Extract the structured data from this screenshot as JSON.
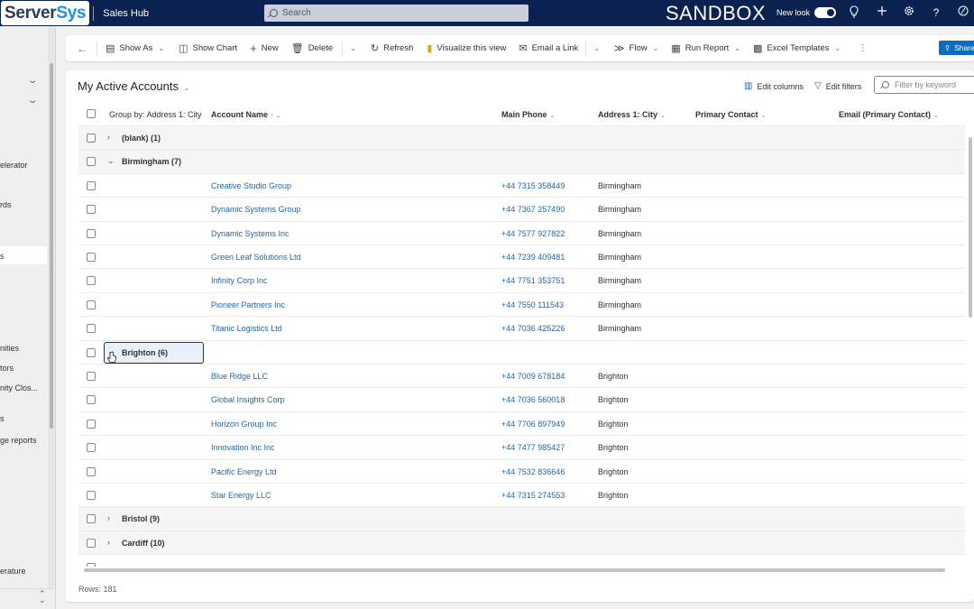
{
  "topbar": {
    "logo_part1": "Server",
    "logo_part2": "Sys",
    "app_name": "Sales Hub",
    "search_placeholder": "Search",
    "environment_label": "SANDBOX",
    "new_look_label": "New look",
    "new_look_enabled": true,
    "icons": [
      "lightbulb-icon",
      "plus-icon",
      "settings-icon",
      "help-icon",
      "copilot-icon"
    ]
  },
  "sidebar": {
    "items": [
      {
        "label": "",
        "has_chevron": true
      },
      {
        "label": "",
        "has_chevron": true
      },
      {
        "label": "elerator"
      },
      {
        "label": "rds"
      },
      {
        "label": "s",
        "selected": true
      },
      {
        "label": "nities"
      },
      {
        "label": "tors"
      },
      {
        "label": "nity Clos..."
      },
      {
        "label": "s"
      },
      {
        "label": "ge reports"
      },
      {
        "label": "erature"
      }
    ]
  },
  "commandbar": {
    "back_label": "←",
    "show_as": "Show As",
    "show_chart": "Show Chart",
    "new": "New",
    "delete": "Delete",
    "refresh": "Refresh",
    "visualize": "Visualize this view",
    "email_link": "Email a Link",
    "flow": "Flow",
    "run_report": "Run Report",
    "excel_templates": "Excel Templates",
    "share": "Share"
  },
  "view": {
    "title": "My Active Accounts",
    "edit_columns": "Edit columns",
    "edit_filters": "Edit filters",
    "filter_placeholder": "Filter by keyword"
  },
  "grid": {
    "columns": {
      "group_by": "Group by: Address 1: City",
      "account_name": "Account Name",
      "main_phone": "Main Phone",
      "city": "Address 1: City",
      "primary_contact": "Primary Contact",
      "email": "Email (Primary Contact)"
    },
    "groups": [
      {
        "label": "(blank) (1)",
        "expanded": false,
        "rows": []
      },
      {
        "label": "Birmingham (7)",
        "expanded": true,
        "rows": [
          {
            "name": "Creative Studio Group",
            "phone": "+44 7315 358449",
            "city": "Birmingham"
          },
          {
            "name": "Dynamic Systems Group",
            "phone": "+44 7367 257490",
            "city": "Birmingham"
          },
          {
            "name": "Dynamic Systems Inc",
            "phone": "+44 7577 927822",
            "city": "Birmingham"
          },
          {
            "name": "Green Leaf Solutions Ltd",
            "phone": "+44 7239 409481",
            "city": "Birmingham"
          },
          {
            "name": "Infinity Corp Inc",
            "phone": "+44 7751 353751",
            "city": "Birmingham"
          },
          {
            "name": "Pioneer Partners Inc",
            "phone": "+44 7550 111543",
            "city": "Birmingham"
          },
          {
            "name": "Titanic Logistics Ltd",
            "phone": "+44 7036 425226",
            "city": "Birmingham"
          }
        ]
      },
      {
        "label": "Brighton (6)",
        "expanded": true,
        "focused": true,
        "rows": [
          {
            "name": "Blue Ridge LLC",
            "phone": "+44 7009 678184",
            "city": "Brighton"
          },
          {
            "name": "Global Insights Corp",
            "phone": "+44 7036 560018",
            "city": "Brighton"
          },
          {
            "name": "Horizon Group Inc",
            "phone": "+44 7706 897949",
            "city": "Brighton"
          },
          {
            "name": "Innovation Inc Inc",
            "phone": "+44 7477 985427",
            "city": "Brighton"
          },
          {
            "name": "Pacific Energy Ltd",
            "phone": "+44 7532 836646",
            "city": "Brighton"
          },
          {
            "name": "Star Energy LLC",
            "phone": "+44 7315 274553",
            "city": "Brighton"
          }
        ]
      },
      {
        "label": "Bristol (9)",
        "expanded": false,
        "rows": []
      },
      {
        "label": "Cardiff (10)",
        "expanded": false,
        "rows": []
      }
    ],
    "rows_count": "Rows: 181"
  }
}
